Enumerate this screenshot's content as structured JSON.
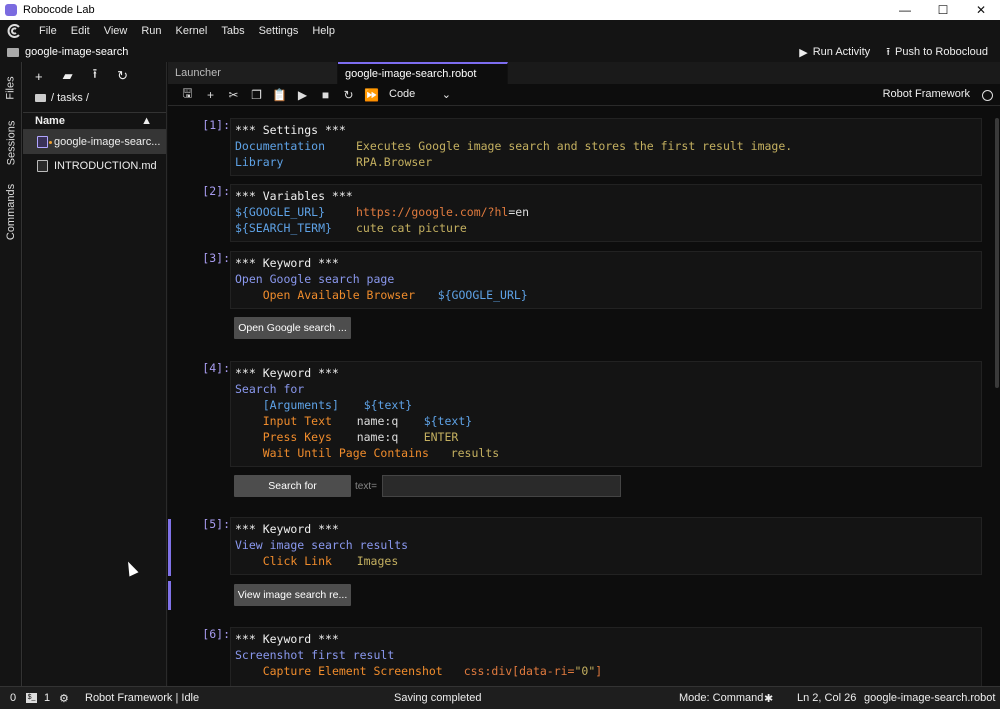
{
  "window": {
    "title": "Robocode Lab",
    "controls": [
      "—",
      "☐",
      "✕"
    ]
  },
  "menu": {
    "items": [
      "File",
      "Edit",
      "View",
      "Run",
      "Kernel",
      "Tabs",
      "Settings",
      "Help"
    ]
  },
  "breadcrumb": {
    "label": "google-image-search"
  },
  "top_actions": {
    "run_activity": "Run Activity",
    "push": "Push to Robocloud"
  },
  "side_tabs": {
    "files": "Files",
    "sessions": "Sessions",
    "commands": "Commands"
  },
  "file_browser": {
    "path": "/ tasks /",
    "column_name": "Name",
    "files": [
      {
        "name": "google-image-searc...",
        "type": "robot",
        "selected": true
      },
      {
        "name": "INTRODUCTION.md",
        "type": "markdown",
        "selected": false
      }
    ]
  },
  "tabs": [
    {
      "label": "Launcher",
      "active": false
    },
    {
      "label": "google-image-search.robot",
      "active": true
    }
  ],
  "notebook_toolbar": {
    "cell_type": "Code",
    "kernel": "Robot Framework"
  },
  "cells": {
    "c1": {
      "prompt": "[1]:",
      "l1": "*** Settings ***",
      "l2a": "Documentation",
      "l2b": "Executes Google image search and stores the first result image.",
      "l3a": "Library",
      "l3b": "RPA.Browser"
    },
    "c2": {
      "prompt": "[2]:",
      "l1": "*** Variables ***",
      "l2a": "${GOOGLE_URL}",
      "l2b": "https://google.com/?hl",
      "l2c": "=en",
      "l3a": "${SEARCH_TERM}",
      "l3b": "cute cat picture"
    },
    "c3": {
      "prompt": "[3]:",
      "l1": "*** Keyword ***",
      "l2": "Open Google search page",
      "l3a": "Open Available Browser",
      "l3b": "${GOOGLE_URL}",
      "button": "Open Google search ..."
    },
    "c4": {
      "prompt": "[4]:",
      "l1": "*** Keyword ***",
      "l2": "Search for",
      "l3a": "[Arguments]",
      "l3b": "${text}",
      "l4a": "Input Text",
      "l4b": "name:q",
      "l4c": "${text}",
      "l5a": "Press Keys",
      "l5b": "name:q",
      "l5c": "ENTER",
      "l6a": "Wait Until Page Contains",
      "l6b": "results",
      "button": "Search for",
      "input_label": "text=",
      "input_value": ""
    },
    "c5": {
      "prompt": "[5]:",
      "l1": "*** Keyword ***",
      "l2": "View image search results",
      "l3a": "Click Link",
      "l3b": "Images",
      "button": "View image search re..."
    },
    "c6": {
      "prompt": "[6]:",
      "l1": "*** Keyword ***",
      "l2": "Screenshot first result",
      "l3a": "Capture Element Screenshot",
      "l3b": "css:div[data-ri=",
      "l3c": "\"0\"",
      "l3d": "]"
    }
  },
  "status": {
    "count0": "0",
    "count1": "1",
    "kernel_status": "Robot Framework | Idle",
    "saving": "Saving completed",
    "mode": "Mode: Command",
    "position": "Ln 2, Col 26",
    "file": "google-image-search.robot"
  },
  "colors": {
    "accent": "#7d6df0",
    "background": "#0d0d0d"
  }
}
